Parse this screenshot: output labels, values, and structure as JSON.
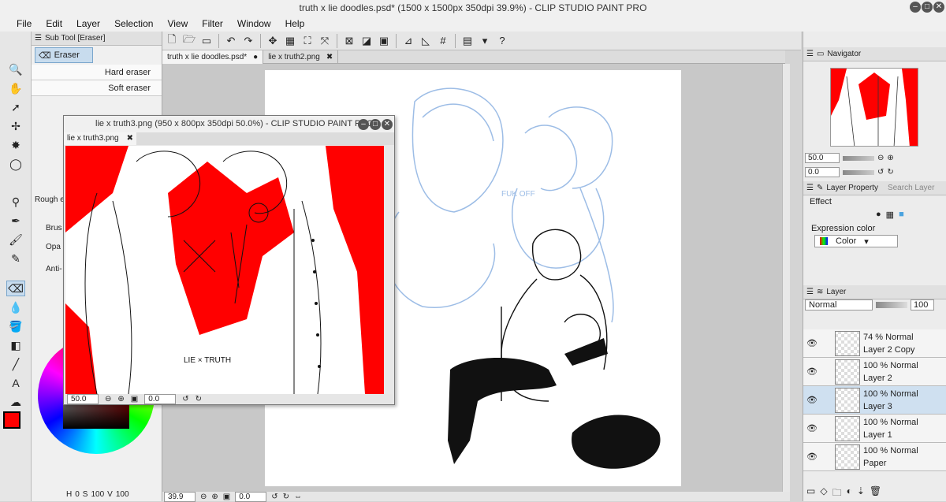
{
  "app": {
    "title": "truth x lie doodles.psd* (1500 x 1500px 350dpi 39.9%)  - CLIP STUDIO PAINT PRO"
  },
  "menu": [
    "File",
    "Edit",
    "Layer",
    "Selection",
    "View",
    "Filter",
    "Window",
    "Help"
  ],
  "subtool": {
    "header": "Sub Tool [Eraser]",
    "group": "Eraser",
    "brushes": [
      "Hard eraser",
      "Soft eraser"
    ],
    "rough": "Rough e",
    "props": [
      "Brus",
      "Opa",
      "Anti-"
    ]
  },
  "tabs": [
    {
      "label": "truth x lie doodles.psd*",
      "close": "●"
    },
    {
      "label": "lie x truth2.png",
      "close": "✖"
    }
  ],
  "subwindow": {
    "title": "lie x truth3.png (950 x 800px 350dpi 50.0%) - CLIP STUDIO PAINT PRO",
    "tab": "lie x truth3.png",
    "close": "✖",
    "zoom": "50.0",
    "angle": "0.0",
    "artwork_text": "LIE × TRUTH"
  },
  "canvas_status": {
    "zoom": "39.9",
    "angle": "0.0"
  },
  "navigator": {
    "title": "Navigator",
    "zoom": "50.0",
    "angle": "0.0"
  },
  "layer_property": {
    "title": "Layer Property",
    "search": "Search Layer",
    "effect": "Effect",
    "expression_label": "Expression color",
    "expression_value": "Color"
  },
  "layer_panel": {
    "title": "Layer",
    "blend_mode": "Normal",
    "opacity": "100",
    "layers": [
      {
        "opacity": "74 %",
        "mode": "Normal",
        "name": "Layer 2 Copy",
        "selected": false
      },
      {
        "opacity": "100 %",
        "mode": "Normal",
        "name": "Layer 2",
        "selected": false
      },
      {
        "opacity": "100 %",
        "mode": "Normal",
        "name": "Layer 3",
        "selected": true
      },
      {
        "opacity": "100 %",
        "mode": "Normal",
        "name": "Layer 1",
        "selected": false
      },
      {
        "opacity": "100 %",
        "mode": "Normal",
        "name": "Paper",
        "selected": false
      }
    ]
  },
  "color_readout": {
    "h": "0",
    "s": "100",
    "v": "100"
  },
  "colors": {
    "main": "#ff0000",
    "accent_blue": "#7aa6cc",
    "sketch_blue": "#9dbde6"
  }
}
